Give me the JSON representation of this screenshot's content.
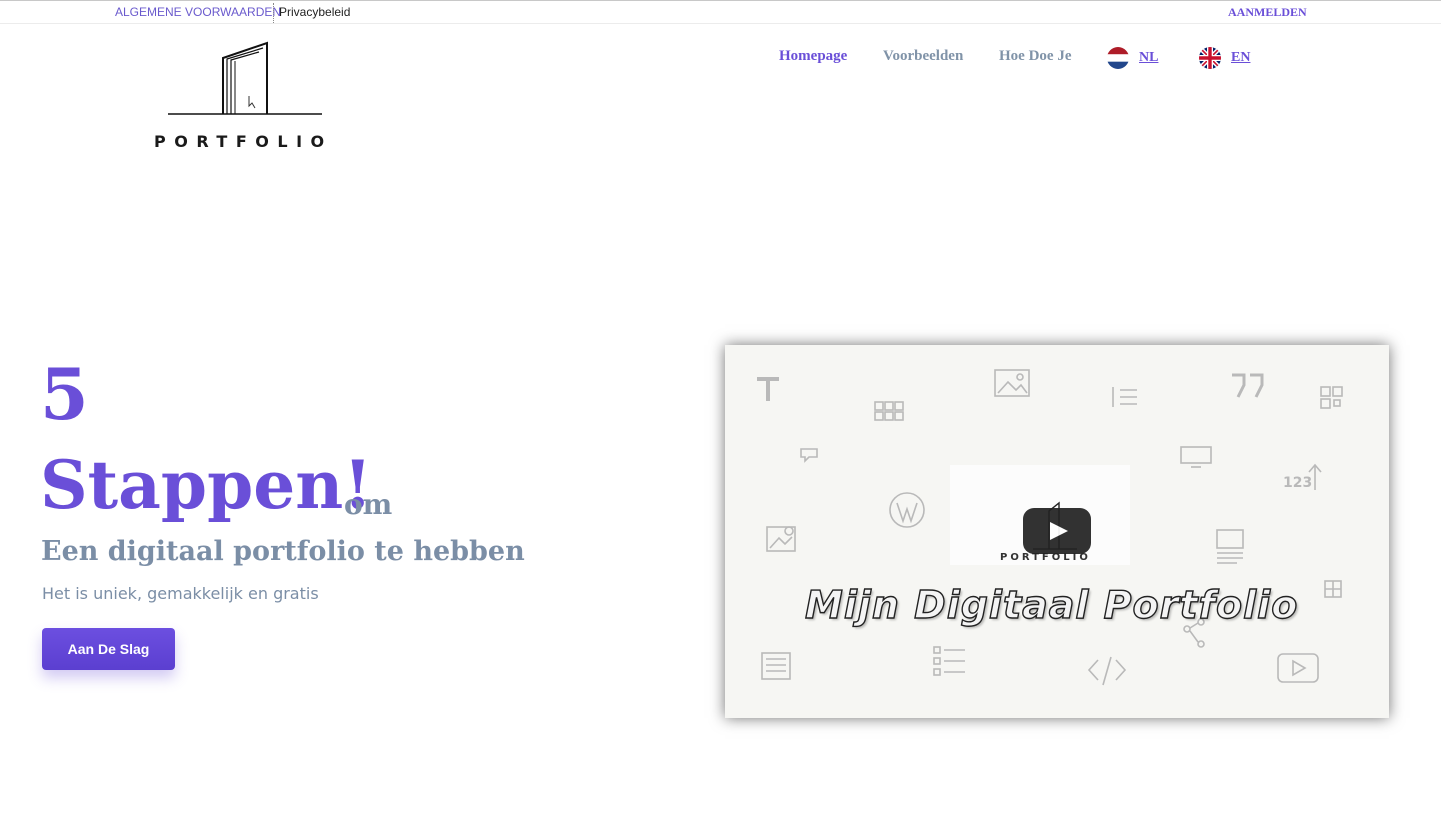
{
  "topbar": {
    "terms_label": "ALGEMENE VOORWAARDEN",
    "privacy_label": "Privacybeleid",
    "login_label": "AANMELDEN"
  },
  "logo": {
    "wordmark": "PORTFOLIO"
  },
  "nav": {
    "items": [
      {
        "label": "Homepage",
        "active": true
      },
      {
        "label": "Voorbeelden",
        "active": false
      },
      {
        "label": "Hoe Doe Je",
        "active": false
      }
    ],
    "languages": [
      {
        "code": "NL",
        "icon": "netherlands-flag-icon"
      },
      {
        "code": "EN",
        "icon": "uk-flag-icon"
      }
    ]
  },
  "hero": {
    "number": "5",
    "title": "Stappen!",
    "connector": "om",
    "subtitle": "Een digitaal portfolio te hebben",
    "description": "Het is uniek, gemakkelijk en gratis",
    "cta_label": "Aan De Slag"
  },
  "video": {
    "logo_text": "PORTFOLIO",
    "title": "Mijn Digitaal Portfolio",
    "play_icon": "play-icon"
  },
  "colors": {
    "accent": "#6a4fd8",
    "muted": "#7b8ea6",
    "video_bg": "#f6f6f3"
  }
}
